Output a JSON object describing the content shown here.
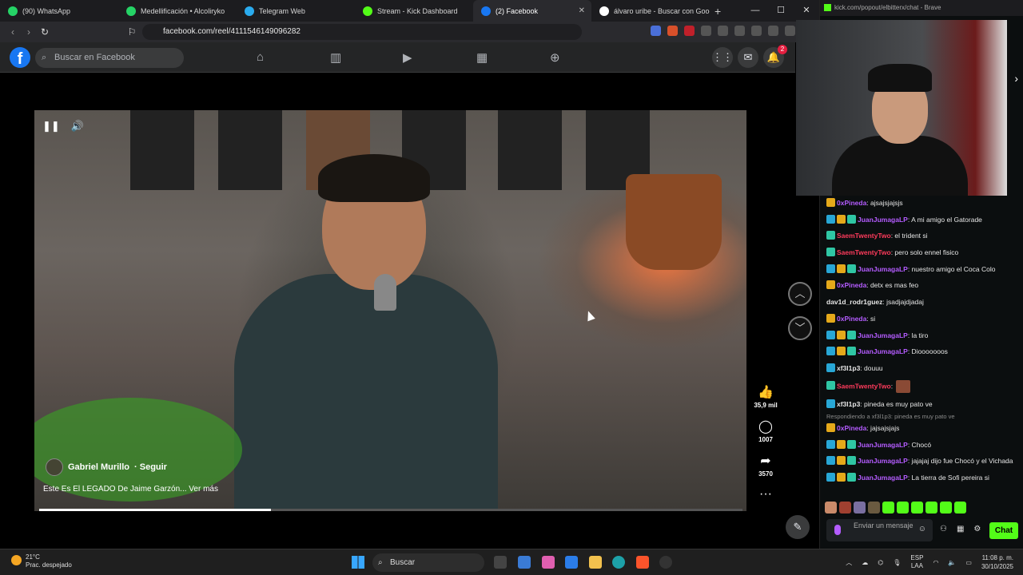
{
  "browser": {
    "tabs": [
      {
        "label": "(90) WhatsApp",
        "color": "#25d366"
      },
      {
        "label": "Medellificación • Alcoliryko",
        "color": "#25d366"
      },
      {
        "label": "Telegram Web",
        "color": "#2aabee"
      },
      {
        "label": "Stream - Kick Dashboard",
        "color": "#53fc18"
      },
      {
        "label": "(2) Facebook",
        "color": "#1877f2"
      },
      {
        "label": "álvaro uribe - Buscar con Google",
        "color": "#ffffff"
      }
    ],
    "url": "facebook.com/reel/4111546149096282"
  },
  "facebook": {
    "search_placeholder": "Buscar en Facebook",
    "notification_count": "2",
    "reel": {
      "author": "Gabriel Murillo",
      "follow": "· Seguir",
      "caption": "Este Es El LEGADO De Jaime Garzón... Ver más",
      "progress": 0.33,
      "likes": "35,9 mil",
      "comments": "1007",
      "shares": "3570"
    }
  },
  "kick": {
    "popout_url": "kick.com/popout/elbitterx/chat - Brave",
    "input_placeholder": "Enviar un mensaje",
    "chat_button": "Chat",
    "messages": [
      {
        "badges": [
          "crown"
        ],
        "user": "0xPineda",
        "color": "#b45cff",
        "text": ": ajsajsjajsjs"
      },
      {
        "badges": [
          "sub",
          "crown",
          "og"
        ],
        "user": "JuanJumagaLP",
        "color": "#b45cff",
        "text": ": A mi amigo el Gatorade"
      },
      {
        "badges": [
          "og"
        ],
        "user": "SaemTwentyTwo",
        "color": "#ff3b5c",
        "text": ": el trident si"
      },
      {
        "badges": [
          "og"
        ],
        "user": "SaemTwentyTwo",
        "color": "#ff3b5c",
        "text": ": pero solo ennel fisico"
      },
      {
        "badges": [
          "sub",
          "crown",
          "og"
        ],
        "user": "JuanJumagaLP",
        "color": "#b45cff",
        "text": ": nuestro amigo el Coca Colo"
      },
      {
        "badges": [
          "crown"
        ],
        "user": "0xPineda",
        "color": "#b45cff",
        "text": ": detx es mas feo"
      },
      {
        "badges": [],
        "user": "dav1d_rodr1guez",
        "color": "#e6e6e6",
        "text": ": jsadjajdjadaj"
      },
      {
        "badges": [
          "crown"
        ],
        "user": "0xPineda",
        "color": "#b45cff",
        "text": ": si"
      },
      {
        "badges": [
          "sub",
          "crown",
          "og"
        ],
        "user": "JuanJumagaLP",
        "color": "#b45cff",
        "text": ": la tiro"
      },
      {
        "badges": [
          "sub",
          "crown",
          "og"
        ],
        "user": "JuanJumagaLP",
        "color": "#b45cff",
        "text": ": Diooooooos"
      },
      {
        "badges": [
          "sub"
        ],
        "user": "xf3l1p3",
        "color": "#e6e6e6",
        "text": ": douuu"
      },
      {
        "badges": [
          "og"
        ],
        "user": "SaemTwentyTwo",
        "color": "#ff3b5c",
        "text": ":",
        "emote": true
      },
      {
        "badges": [
          "sub"
        ],
        "user": "xf3l1p3",
        "color": "#e6e6e6",
        "text": ": pineda es muy pato ve"
      },
      {
        "reply": "Respondiendo a xf3l1p3: pineda es muy pato ve",
        "badges": [
          "crown"
        ],
        "user": "0xPineda",
        "color": "#b45cff",
        "text": ": jajsajsjajs"
      },
      {
        "badges": [
          "sub",
          "crown",
          "og"
        ],
        "user": "JuanJumagaLP",
        "color": "#b45cff",
        "text": ": Chocó"
      },
      {
        "badges": [
          "sub",
          "crown",
          "og"
        ],
        "user": "JuanJumagaLP",
        "color": "#b45cff",
        "text": ": jajajaj dijo fue Chocó y el Vichada"
      },
      {
        "badges": [
          "sub",
          "crown",
          "og"
        ],
        "user": "JuanJumagaLP",
        "color": "#b45cff",
        "text": ": La tierra de Sofi pereira si"
      }
    ]
  },
  "taskbar": {
    "temperature": "21°C",
    "weather": "Prac. despejado",
    "search": "Buscar",
    "lang_top": "ESP",
    "lang_bottom": "LAA",
    "time": "11:08 p. m.",
    "date": "30/10/2025"
  }
}
